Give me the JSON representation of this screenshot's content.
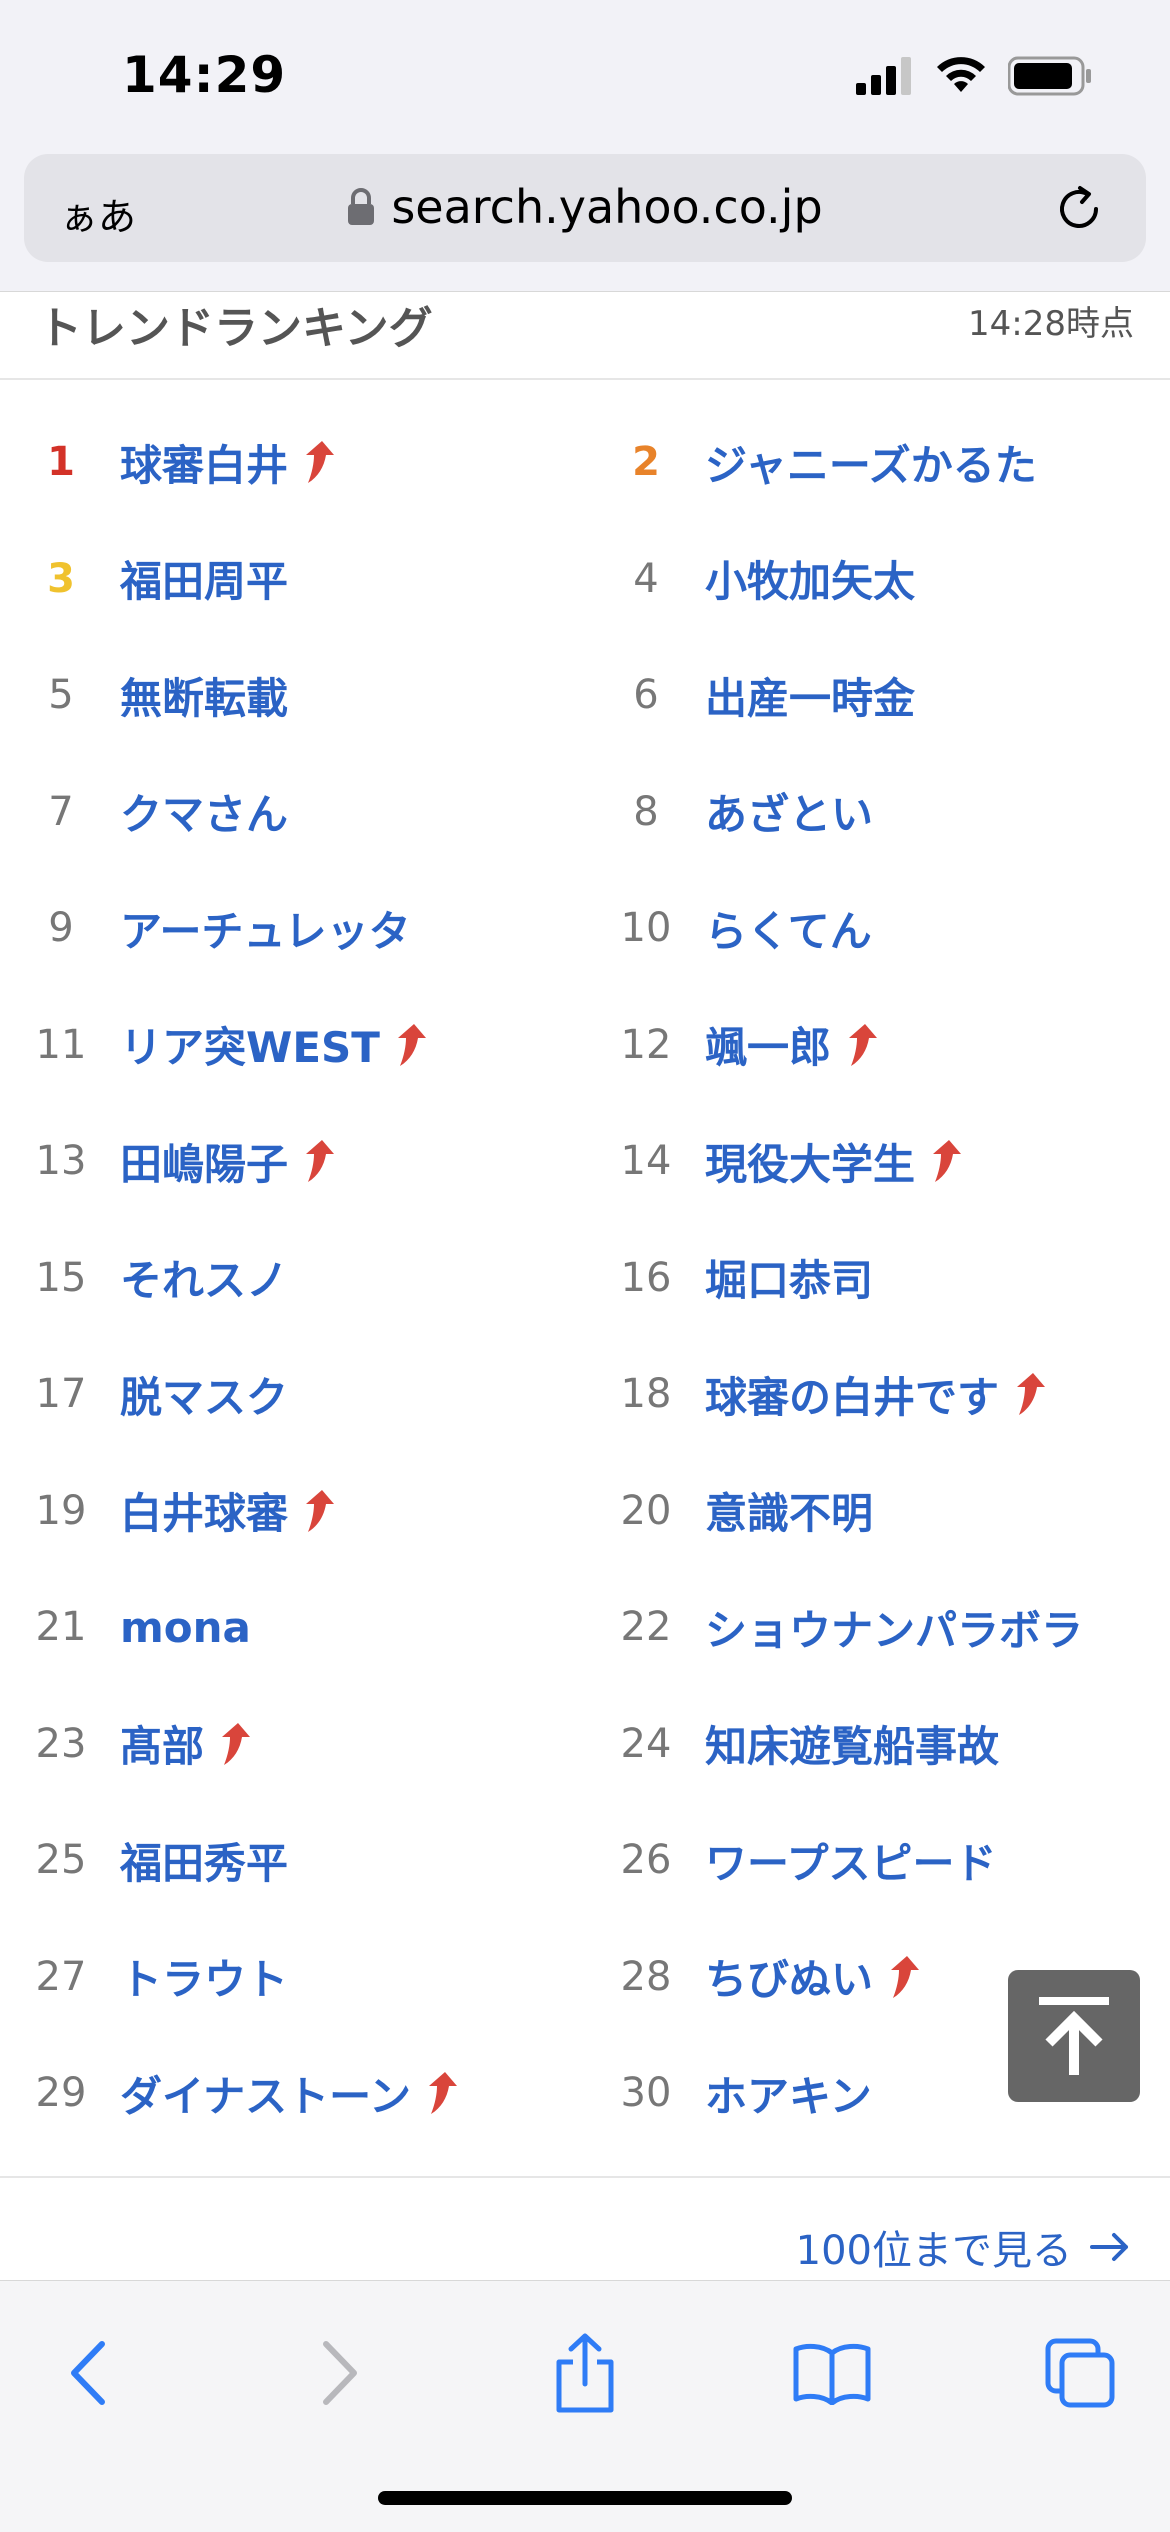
{
  "status": {
    "time": "14:29"
  },
  "browser": {
    "text_size": "ぁあ",
    "url": "search.yahoo.co.jp"
  },
  "header": {
    "title": "トレンドランキング",
    "updated": "14:28時点"
  },
  "ranking": [
    {
      "rank": "1",
      "term": "球審白井",
      "rising": true
    },
    {
      "rank": "2",
      "term": "ジャニーズかるた",
      "rising": false
    },
    {
      "rank": "3",
      "term": "福田周平",
      "rising": false
    },
    {
      "rank": "4",
      "term": "小牧加矢太",
      "rising": false
    },
    {
      "rank": "5",
      "term": "無断転載",
      "rising": false
    },
    {
      "rank": "6",
      "term": "出産一時金",
      "rising": false
    },
    {
      "rank": "7",
      "term": "クマさん",
      "rising": false
    },
    {
      "rank": "8",
      "term": "あざとい",
      "rising": false
    },
    {
      "rank": "9",
      "term": "アーチュレッタ",
      "rising": false
    },
    {
      "rank": "10",
      "term": "らくてん",
      "rising": false
    },
    {
      "rank": "11",
      "term": "リア突WEST",
      "rising": true
    },
    {
      "rank": "12",
      "term": "颯一郎",
      "rising": true
    },
    {
      "rank": "13",
      "term": "田嶋陽子",
      "rising": true
    },
    {
      "rank": "14",
      "term": "現役大学生",
      "rising": true
    },
    {
      "rank": "15",
      "term": "それスノ",
      "rising": false
    },
    {
      "rank": "16",
      "term": "堀口恭司",
      "rising": false
    },
    {
      "rank": "17",
      "term": "脱マスク",
      "rising": false
    },
    {
      "rank": "18",
      "term": "球審の白井です",
      "rising": true
    },
    {
      "rank": "19",
      "term": "白井球審",
      "rising": true
    },
    {
      "rank": "20",
      "term": "意識不明",
      "rising": false
    },
    {
      "rank": "21",
      "term": "mona",
      "rising": false
    },
    {
      "rank": "22",
      "term": "ショウナンパラボラ",
      "rising": false
    },
    {
      "rank": "23",
      "term": "髙部",
      "rising": true
    },
    {
      "rank": "24",
      "term": "知床遊覧船事故",
      "rising": false
    },
    {
      "rank": "25",
      "term": "福田秀平",
      "rising": false
    },
    {
      "rank": "26",
      "term": "ワープスピード",
      "rising": false
    },
    {
      "rank": "27",
      "term": "トラウト",
      "rising": false
    },
    {
      "rank": "28",
      "term": "ちびぬい",
      "rising": true
    },
    {
      "rank": "29",
      "term": "ダイナストーン",
      "rising": true
    },
    {
      "rank": "30",
      "term": "ホアキン",
      "rising": false
    }
  ],
  "footer": {
    "more_label": "100位まで見る"
  },
  "colors": {
    "link": "#2b63c5",
    "rank1": "#d33228",
    "rank2": "#e8832a",
    "rank3": "#f0c22e",
    "rise_arrow": "#d9453b"
  }
}
